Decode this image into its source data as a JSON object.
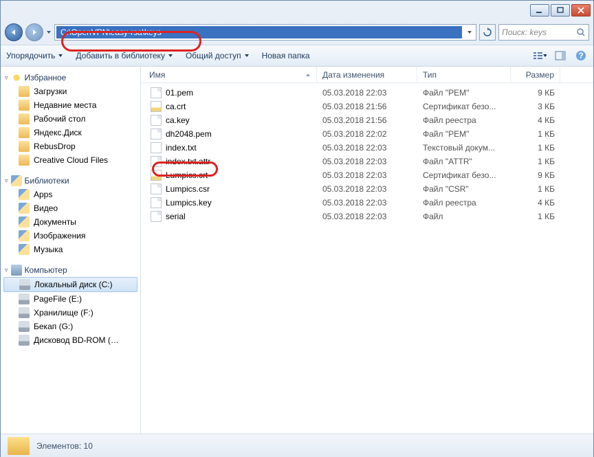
{
  "window": {
    "address_path": "C:\\OpenVPN\\easy-rsa\\keys",
    "search_placeholder": "Поиск: keys"
  },
  "toolbar": {
    "organize": "Упорядочить",
    "add_to_library": "Добавить в библиотеку",
    "share": "Общий доступ",
    "new_folder": "Новая папка"
  },
  "sidebar": {
    "favorites": {
      "label": "Избранное",
      "items": [
        {
          "label": "Загрузки"
        },
        {
          "label": "Недавние места"
        },
        {
          "label": "Рабочий стол"
        },
        {
          "label": "Яндекс.Диск"
        },
        {
          "label": "RebusDrop"
        },
        {
          "label": "Creative Cloud Files"
        }
      ]
    },
    "libraries": {
      "label": "Библиотеки",
      "items": [
        {
          "label": "Apps"
        },
        {
          "label": "Видео"
        },
        {
          "label": "Документы"
        },
        {
          "label": "Изображения"
        },
        {
          "label": "Музыка"
        }
      ]
    },
    "computer": {
      "label": "Компьютер",
      "items": [
        {
          "label": "Локальный диск (C:)",
          "selected": true
        },
        {
          "label": "PageFile (E:)"
        },
        {
          "label": "Хранилище (F:)"
        },
        {
          "label": "Бекап (G:)"
        },
        {
          "label": "Дисковод BD-ROM (…"
        }
      ]
    }
  },
  "columns": {
    "name": "Имя",
    "date": "Дата изменения",
    "type": "Тип",
    "size": "Размер"
  },
  "files": [
    {
      "name": "01.pem",
      "date": "05.03.2018 22:03",
      "type": "Файл \"PEM\"",
      "size": "9 КБ",
      "icon": "file"
    },
    {
      "name": "ca.crt",
      "date": "05.03.2018 21:56",
      "type": "Сертификат безо...",
      "size": "3 КБ",
      "icon": "cert"
    },
    {
      "name": "ca.key",
      "date": "05.03.2018 21:56",
      "type": "Файл реестра",
      "size": "4 КБ",
      "icon": "file"
    },
    {
      "name": "dh2048.pem",
      "date": "05.03.2018 22:02",
      "type": "Файл \"PEM\"",
      "size": "1 КБ",
      "icon": "file"
    },
    {
      "name": "index.txt",
      "date": "05.03.2018 22:03",
      "type": "Текстовый докум...",
      "size": "1 КБ",
      "icon": "txt"
    },
    {
      "name": "index.txt.attr",
      "date": "05.03.2018 22:03",
      "type": "Файл \"ATTR\"",
      "size": "1 КБ",
      "icon": "file"
    },
    {
      "name": "Lumpics.crt",
      "date": "05.03.2018 22:03",
      "type": "Сертификат безо...",
      "size": "9 КБ",
      "icon": "cert"
    },
    {
      "name": "Lumpics.csr",
      "date": "05.03.2018 22:03",
      "type": "Файл \"CSR\"",
      "size": "1 КБ",
      "icon": "file"
    },
    {
      "name": "Lumpics.key",
      "date": "05.03.2018 22:03",
      "type": "Файл реестра",
      "size": "4 КБ",
      "icon": "file"
    },
    {
      "name": "serial",
      "date": "05.03.2018 22:03",
      "type": "Файл",
      "size": "1 КБ",
      "icon": "file"
    }
  ],
  "status": {
    "count_label": "Элементов: 10"
  }
}
